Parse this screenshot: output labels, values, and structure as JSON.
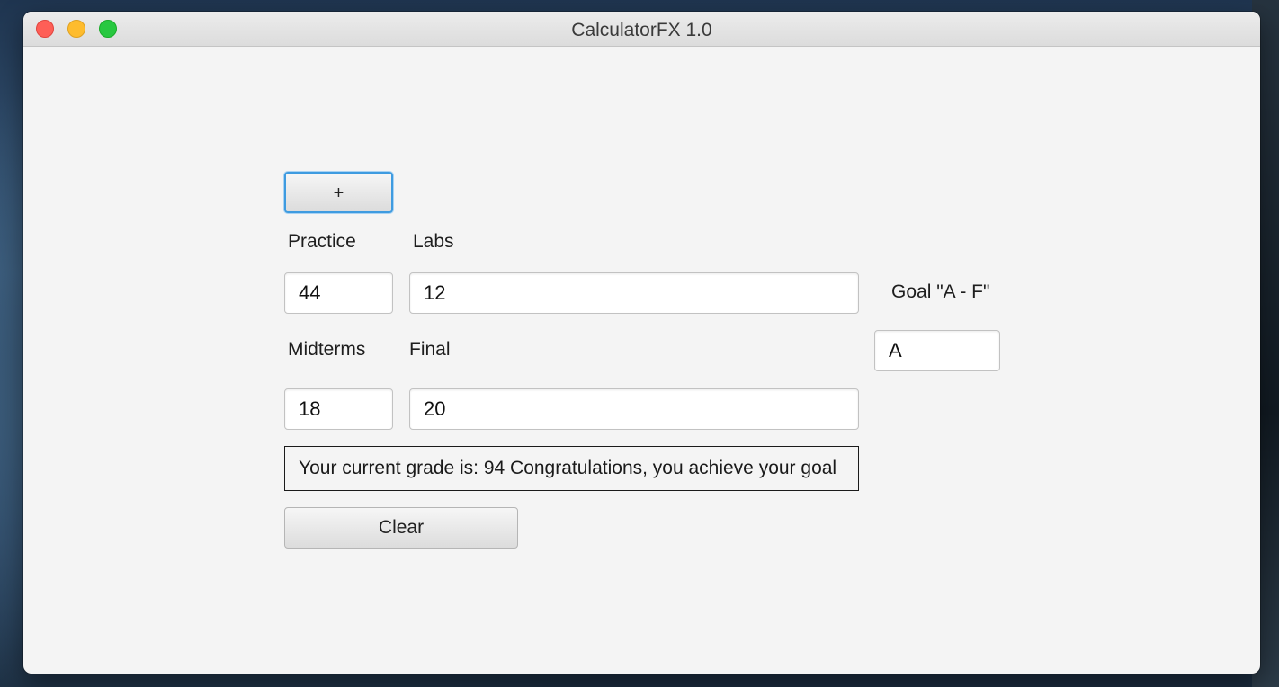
{
  "window": {
    "title": "CalculatorFX 1.0"
  },
  "buttons": {
    "add_label": "+",
    "clear_label": "Clear"
  },
  "labels": {
    "practice": "Practice",
    "labs": "Labs",
    "midterms": "Midterms",
    "final": "Final",
    "goal": "Goal  \"A - F\""
  },
  "fields": {
    "practice": "44",
    "labs": "12",
    "midterms": "18",
    "final": "20",
    "goal": "A"
  },
  "result": {
    "text": "Your current grade is: 94  Congratulations, you achieve your goal"
  },
  "colors": {
    "focus_ring": "#3e9be0",
    "close": "#fe5f57",
    "minimize": "#febc2e",
    "maximize": "#28c840"
  }
}
